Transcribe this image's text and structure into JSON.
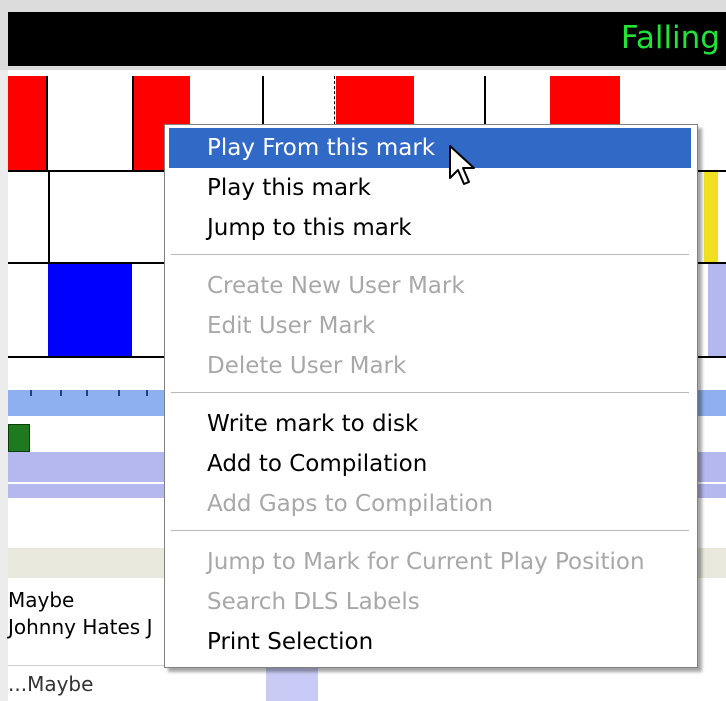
{
  "header": {
    "title": "Falling"
  },
  "tracks": {
    "row1_colors": [
      "#ff0000",
      "#ffffff",
      "#ff0000",
      "#ffffff",
      "#ffffff",
      "#ff0000",
      "#ffffff",
      "#ffffff",
      "#ff0000",
      "#ffffff"
    ],
    "row2_accent": "#f0e020",
    "row3_block": "#0000ff"
  },
  "playlist": {
    "rows": [
      "Maybe",
      "Johnny Hates J",
      "...Maybe"
    ]
  },
  "context_menu": {
    "items": [
      {
        "label": "Play From this mark",
        "enabled": true,
        "selected": true
      },
      {
        "label": "Play this mark",
        "enabled": true
      },
      {
        "label": "Jump to this mark",
        "enabled": true
      },
      {
        "label": "Create New User Mark",
        "enabled": false
      },
      {
        "label": "Edit User Mark",
        "enabled": false
      },
      {
        "label": "Delete User Mark",
        "enabled": false
      },
      {
        "label": "Write mark to disk",
        "enabled": true
      },
      {
        "label": "Add to Compilation",
        "enabled": true
      },
      {
        "label": "Add Gaps to Compilation",
        "enabled": false
      },
      {
        "label": "Jump to Mark for Current Play Position",
        "enabled": false
      },
      {
        "label": "Search DLS Labels",
        "enabled": false
      },
      {
        "label": "Print Selection",
        "enabled": true
      }
    ]
  },
  "colors": {
    "title_text": "#22e33a",
    "menu_highlight": "#3169c6",
    "disabled_text": "#a8a8a8"
  },
  "cursor": {
    "icon": "arrow-cursor-icon"
  }
}
